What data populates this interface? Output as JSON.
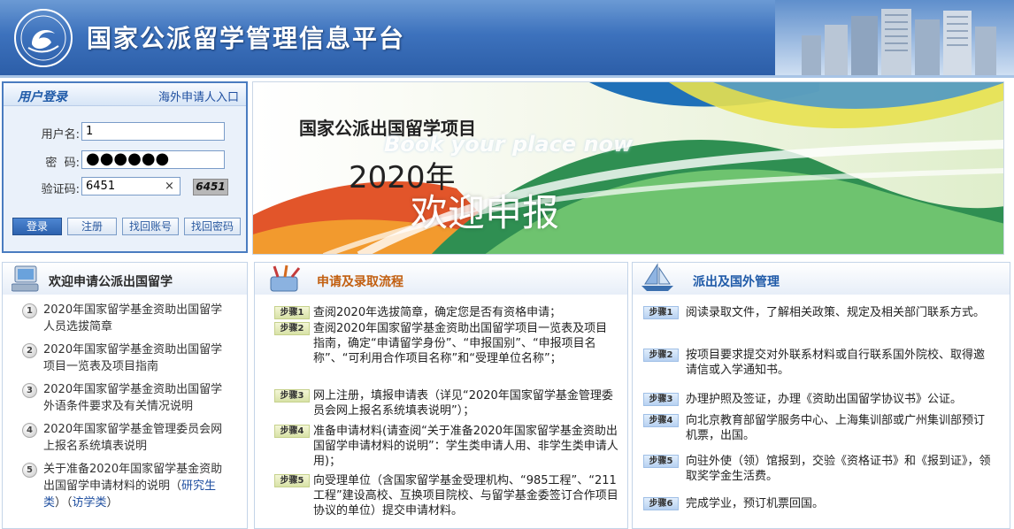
{
  "header": {
    "title": "国家公派留学管理信息平台",
    "logo_icon": "csc-logo-icon"
  },
  "login": {
    "title": "用户登录",
    "overseas_link": "海外申请人入口",
    "username_label": "用户名:",
    "username_value": "1",
    "password_label": "密  码:",
    "password_mask": "●●●●●●",
    "captcha_label": "验证码:",
    "captcha_value": "6451",
    "captcha_clear": "×",
    "captcha_image_text": "6451",
    "buttons": {
      "login": "登录",
      "register": "注册",
      "find_account": "找回账号",
      "find_password": "找回密码"
    }
  },
  "banner": {
    "line1": "国家公派出国留学项目",
    "line2": "Book your place now",
    "line3": "2020年",
    "line4": "欢迎申报"
  },
  "welcome": {
    "title": "欢迎申请公派出国留学",
    "items": [
      {
        "num": "1",
        "text": "2020年国家留学基金资助出国留学人员选拔简章"
      },
      {
        "num": "2",
        "text": "2020年国家留学基金资助出国留学项目一览表及项目指南"
      },
      {
        "num": "3",
        "text": "2020年国家留学基金资助出国留学外语条件要求及有关情况说明"
      },
      {
        "num": "4",
        "text": "2020年国家留学基金管理委员会网上报名系统填表说明"
      },
      {
        "num": "5",
        "text": "关于准备2020年国家留学基金资助出国留学申请材料的说明",
        "link1": "研究生类",
        "link2": "访学类"
      }
    ]
  },
  "process": {
    "title": "申请及录取流程",
    "steps": [
      {
        "tag": "步骤1",
        "text": "查阅2020年选拔简章，确定您是否有资格申请；"
      },
      {
        "tag": "步骤2",
        "text": "查阅2020年国家留学基金资助出国留学项目一览表及项目指南，确定“申请留学身份”、“申报国别”、“申报项目名称”、“可利用合作项目名称”和“受理单位名称”；"
      },
      {
        "tag": "步骤3",
        "text": "网上注册，填报申请表（详见“2020年国家留学基金管理委员会网上报名系统填表说明”）；"
      },
      {
        "tag": "步骤4",
        "text": "准备申请材料(请查阅“关于准备2020年国家留学基金资助出国留学申请材料的说明”：学生类申请人用、非学生类申请人用)；"
      },
      {
        "tag": "步骤5",
        "text": "向受理单位（含国家留学基金受理机构、“985工程”、“211工程”建设高校、互换项目院校、与留学基金委签订合作项目协议的单位）提交申请材料。"
      }
    ]
  },
  "dispatch": {
    "title": "派出及国外管理",
    "steps": [
      {
        "tag": "步骤1",
        "text": "阅读录取文件，了解相关政策、规定及相关部门联系方式。"
      },
      {
        "tag": "步骤2",
        "text": "按项目要求提交对外联系材料或自行联系国外院校、取得邀请信或入学通知书。"
      },
      {
        "tag": "步骤3",
        "text": "办理护照及签证，办理《资助出国留学协议书》公证。"
      },
      {
        "tag": "步骤4",
        "text": "向北京教育部留学服务中心、上海集训部或广州集训部预订机票，出国。"
      },
      {
        "tag": "步骤5",
        "text": "向驻外使（领）馆报到，交验《资格证书》和《报到证》，领取奖学金生活费。"
      },
      {
        "tag": "步骤6",
        "text": "完成学业，预订机票回国。"
      }
    ]
  },
  "colors": {
    "header_blue": "#2c5ea8",
    "process_title": "#c25f10",
    "dispatch_title": "#1f5aa8"
  }
}
